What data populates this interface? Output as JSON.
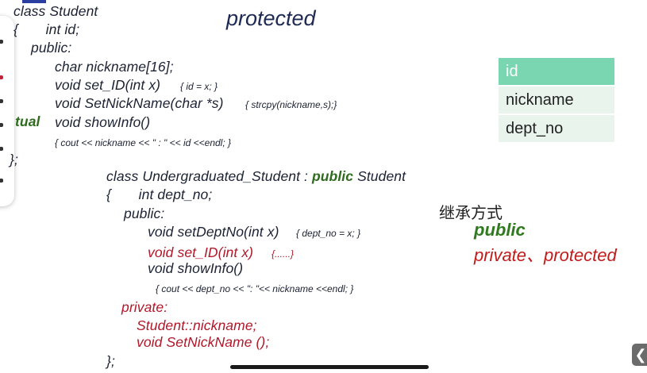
{
  "slide": {
    "title": "protected"
  },
  "base_class": {
    "header": "class Student",
    "line_brace_id": "{       int id;",
    "access_public": "public:",
    "member_nickname": "char nickname[16];",
    "method_setid": "void set_ID(int x)",
    "method_setid_body": "{ id = x; }",
    "method_setnick": "void SetNickName(char *s)",
    "method_setnick_body": "{ strcpy(nickname,s);}",
    "virtual_fragment": "tual",
    "method_showinfo": "void showInfo()",
    "method_showinfo_body": "{ cout << nickname << \" : \" << id <<endl; }",
    "close": "};"
  },
  "derived_class": {
    "header_pre": "class Undergraduated_Student : ",
    "header_kw": "public",
    "header_post": " Student",
    "line_brace_dept": "{       int dept_no;",
    "access_public": "public:",
    "method_setdept": "void setDeptNo(int x)",
    "method_setdept_body": "{ dept_no = x; }",
    "method_setid": "void set_ID(int x)",
    "method_setid_body": "{......}",
    "method_showinfo": "void showInfo()",
    "method_showinfo_body": "{ cout << dept_no << \": \"<< nickname <<endl; }",
    "access_private": "private:",
    "private_member": "Student::nickname;",
    "private_method": "void SetNickName ();",
    "close": "};"
  },
  "field_table": {
    "header": "id",
    "rows": [
      "nickname",
      "dept_no"
    ]
  },
  "inheritance": {
    "label": "继承方式",
    "mode_public": "public",
    "mode_other": "private、protected"
  },
  "controls": {
    "back_glyph": "❮"
  },
  "colors": {
    "code_text": "#1c2233",
    "override_red": "#b0182a",
    "keyword_green": "#2f6b1e",
    "table_header": "#79d6b0",
    "table_row": "#e8f4ec"
  }
}
